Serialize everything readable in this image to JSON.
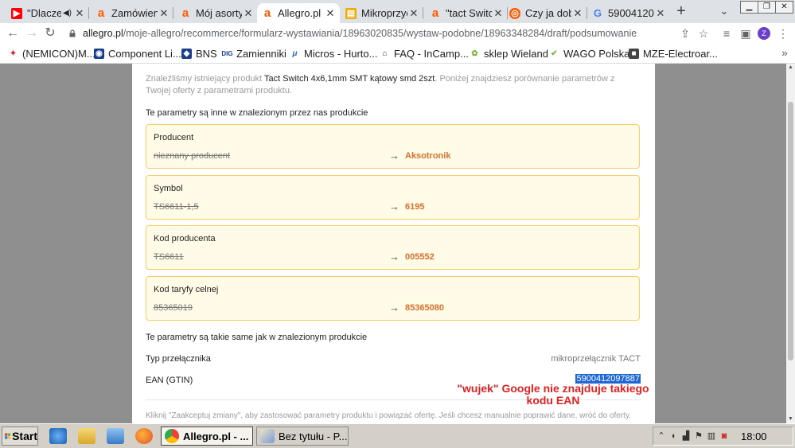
{
  "tabs": [
    {
      "title": "\"Dlacze",
      "icon": "youtube-icon",
      "color": "#ff0000"
    },
    {
      "title": "Zamówieni",
      "icon": "allegro-icon",
      "color": "#ff5a00"
    },
    {
      "title": "Mój asorty",
      "icon": "allegro-icon",
      "color": "#ff5a00"
    },
    {
      "title": "Allegro.pl -",
      "icon": "allegro-icon",
      "color": "#ff5a00"
    },
    {
      "title": "Mikroprzyc",
      "icon": "page-icon",
      "color": "#f2a900"
    },
    {
      "title": "\"tact Switc",
      "icon": "allegro-icon",
      "color": "#ff5a00"
    },
    {
      "title": "Czy ja dob",
      "icon": "allegro-community-icon",
      "color": "#ff5a00"
    },
    {
      "title": "590041209",
      "icon": "google-icon",
      "color": "#4285f4"
    }
  ],
  "window_controls": [
    "minimize",
    "maximize",
    "close"
  ],
  "address": {
    "host": "allegro.pl",
    "path": "/moje-allegro/recommerce/formularz-wystawiania/18963020835/wystaw-podobne/18963348284/draft/podsumowanie",
    "profile_initial": "Z"
  },
  "bookmarks": [
    {
      "label": "(NEMICON)M...",
      "icon": "nemicon-icon",
      "color": "#c23"
    },
    {
      "label": "Component Li...",
      "icon": "component-icon",
      "color": "#1a3d8c"
    },
    {
      "label": "BNS",
      "icon": "bns-icon",
      "color": "#1a3d8c"
    },
    {
      "label": "Zamienniki",
      "icon": "dig-icon",
      "color": "#1a3d8c"
    },
    {
      "label": "Micros - Hurto...",
      "icon": "micros-icon",
      "color": "#2a6bb8"
    },
    {
      "label": "FAQ - InCamp...",
      "icon": "faq-icon",
      "color": "#333333"
    },
    {
      "label": "sklep Wieland",
      "icon": "wieland-icon",
      "color": "#7bb23a"
    },
    {
      "label": "WAGO Polska",
      "icon": "wago-icon",
      "color": "#6dba3a"
    },
    {
      "label": "MZE-Electroar...",
      "icon": "mze-icon",
      "color": "#444444"
    }
  ],
  "content": {
    "intro_prefix": "Znaleźliśmy istniejący produkt ",
    "intro_product": "Tact Switch 4x6,1mm SMT kątowy smd 2szt",
    "intro_suffix": ". Poniżej znajdziesz porównanie parametrów z Twojej oferty z parametrami produktu.",
    "section_different": "Te parametry są inne w znalezionym przez nas produkcie",
    "different": [
      {
        "label": "Producent",
        "old": "nieznany producent",
        "new": "Aksotronik"
      },
      {
        "label": "Symbol",
        "old": "TS6611-1,5",
        "new": "6195"
      },
      {
        "label": "Kod producenta",
        "old": "TS6611",
        "new": "005552"
      },
      {
        "label": "Kod taryfy celnej",
        "old": "85365019",
        "new": "85365080"
      }
    ],
    "arrow": "→",
    "section_same": "Te parametry są takie same jak w znalezionym produkcie",
    "same": [
      {
        "label": "Typ przełącznika",
        "value": "mikroprzełącznik TACT"
      },
      {
        "label": "EAN (GTIN)",
        "value": "5900412097887"
      }
    ],
    "footer": "Kliknij \"Zaakceptuj zmiany\", aby zastosować parametry produktu i powiązać ofertę. Jeśli chcesz manualnie poprawić dane, wróć do oferty."
  },
  "annotation": "\"wujek\" Google nie znajduje takiego kodu EAN",
  "taskbar": {
    "start": "Start",
    "tasks": [
      {
        "label": "Allegro.pl - ...",
        "icon": "chrome-icon",
        "active": true
      },
      {
        "label": "Bez tytułu - P...",
        "icon": "paint-icon",
        "active": false
      }
    ],
    "clock": "18:00"
  }
}
